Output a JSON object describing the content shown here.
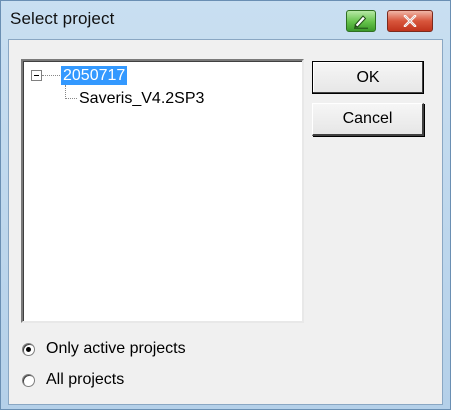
{
  "window": {
    "title": "Select project"
  },
  "titlebar_buttons": {
    "green_icon": "pen-icon",
    "close_icon": "close-icon",
    "close_symbol": "✕"
  },
  "tree": {
    "root": {
      "label": "2050717",
      "expanded": true,
      "selected": true
    },
    "children": [
      {
        "label": "Saveris_V4.2SP3"
      }
    ]
  },
  "buttons": {
    "ok_label": "OK",
    "cancel_label": "Cancel"
  },
  "filter": {
    "options": [
      {
        "label": "Only active projects",
        "checked": true
      },
      {
        "label": "All projects",
        "checked": false
      }
    ]
  },
  "colors": {
    "selection": "#3399ff",
    "close_button": "#c0331c",
    "green_button": "#64c24a"
  }
}
